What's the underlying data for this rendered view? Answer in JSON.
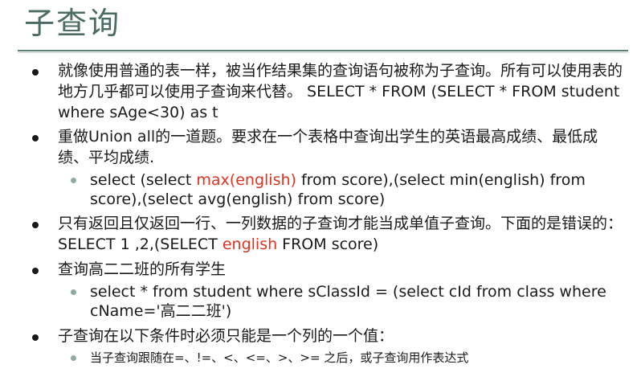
{
  "slide": {
    "title": "子查询",
    "bullets": [
      {
        "text": "就像使用普通的表一样，被当作结果集的查询语句被称为子查询。所有可以使用表的地方几乎都可以使用子查询来代替。 SELECT * FROM (SELECT * FROM student where sAge<30) as t"
      },
      {
        "text": "重做Union all的一道题。要求在一个表格中查询出学生的英语最高成绩、最低成绩、平均成绩.",
        "sub": {
          "part1": "select (select ",
          "highlight": "max(english)",
          "part2": " from score),(select min(english) from score),(select avg(english) from score)"
        }
      },
      {
        "part1": "只有返回且仅返回一行、一列数据的子查询才能当成单值子查询。下面的是错误的：SELECT 1 ,2,(SELECT ",
        "highlight": "english",
        "part2": " FROM score)"
      },
      {
        "text": "查询高二二班的所有学生",
        "sub": {
          "text": "select * from student where sClassId = (select cId from class where cName='高二二班')"
        }
      },
      {
        "text": "子查询在以下条件时必须只能是一个列的一个值：",
        "sub": {
          "text": "当子查询跟随在=、!=、<、<=、>、>= 之后，或子查询用作表达式"
        }
      }
    ]
  },
  "colors": {
    "title": "#4b6b63",
    "highlight": "#e0321e",
    "sub_bullet": "#8fa9a3"
  }
}
